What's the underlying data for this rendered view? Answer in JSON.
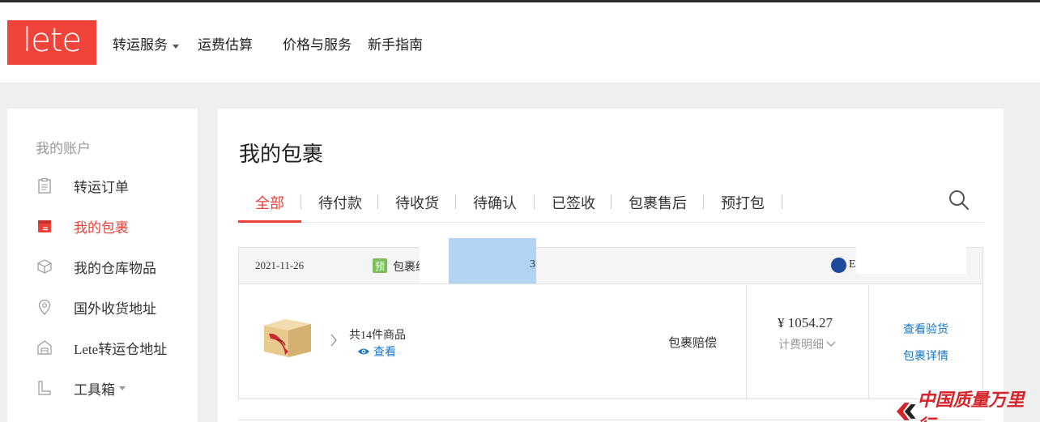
{
  "logo": "lete",
  "nav": [
    "转运服务",
    "运费估算",
    "价格与服务",
    "新手指南"
  ],
  "sidebar": {
    "title": "我的账户",
    "items": [
      {
        "label": "转运订单",
        "icon": "clipboard-icon"
      },
      {
        "label": "我的包裹",
        "icon": "package-box-icon"
      },
      {
        "label": "我的仓库物品",
        "icon": "cube-icon"
      },
      {
        "label": "国外收货地址",
        "icon": "map-pin-icon"
      },
      {
        "label": "Lete转运仓地址",
        "icon": "warehouse-icon"
      },
      {
        "label": "工具箱",
        "icon": "ruler-icon"
      }
    ],
    "active": "我的包裹"
  },
  "main": {
    "title": "我的包裹",
    "tabs": [
      "全部",
      "待付款",
      "待收货",
      "待确认",
      "已签收",
      "包裹售后",
      "预打包"
    ],
    "active_tab": "全部"
  },
  "package": {
    "date": "2021-11-26",
    "badge": "预",
    "number_prefix": "包裹编",
    "number_tail": "3",
    "carrier": "E",
    "item_count": "共14件商品",
    "view": "查看",
    "claim": "包裹赔偿",
    "price": "¥ 1054.27",
    "fee_detail": "计费明细",
    "actions": [
      "查看验货",
      "包裹详情"
    ]
  },
  "watermark": "中国质量万里行",
  "colors": {
    "accent": "#e8423a",
    "link": "#1677c9",
    "badge": "#7bbf5c"
  }
}
